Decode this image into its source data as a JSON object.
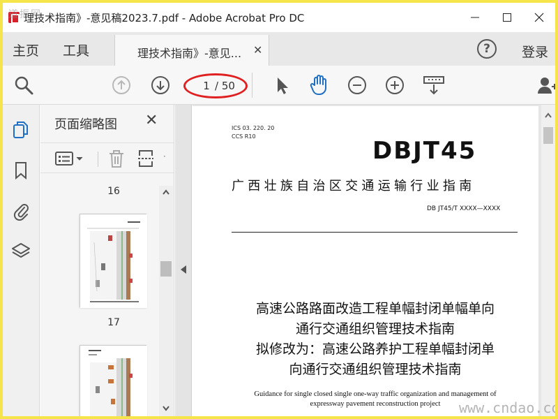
{
  "window": {
    "title": "理技术指南》-意见稿2023.7.pdf - Adobe Acrobat Pro DC",
    "watermark_top_left": "道振网",
    "controls": {
      "minimize": "—",
      "maximize": "☐",
      "close": "✕"
    }
  },
  "menu": {
    "home": "主页",
    "tools": "工具",
    "doc_tab": "理技术指南》-意见...",
    "doc_tab_close": "✕",
    "help": "?",
    "login": "登录"
  },
  "toolbar": {
    "current_page": "1",
    "total_pages": "/ 50"
  },
  "thumbnails": {
    "title": "页面缩略图",
    "close": "✕",
    "pages": [
      {
        "label": "16"
      },
      {
        "label": "17"
      }
    ]
  },
  "document": {
    "ics_line": "ICS   03. 220. 20",
    "ccs_line": "CCS  R10",
    "header_code": "DBJT45",
    "organization": "广西壮族自治区交通运输行业指南",
    "standard_no": "DB JT45/T XXXX—XXXX",
    "title_line1": "高速公路路面改造工程单幅封闭单幅单向",
    "title_line2": "通行交通组织管理技术指南",
    "title_line3": "拟修改为：高速公路养护工程单幅封闭单",
    "title_line4": "向通行交通组织管理技术指南",
    "english_line1": "Guidance for single closed single one-way traffic organization and management of",
    "english_line2": "expressway pavement reconstruction project"
  },
  "watermark_bottom_right": "www.cndao.com",
  "colors": {
    "border": "#f5e44a",
    "accent_blue": "#1f6fc4",
    "annotation_red": "#e02020"
  }
}
